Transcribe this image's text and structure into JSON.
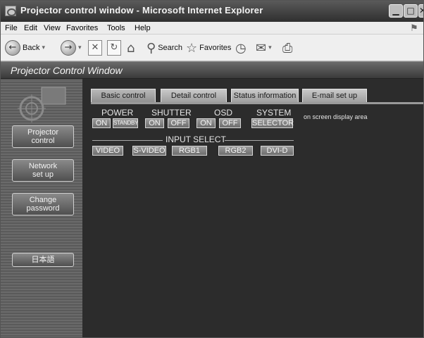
{
  "window": {
    "title": "Projector control window - Microsoft Internet Explorer",
    "controls": [
      "minimize-icon",
      "maximize-icon",
      "close-icon"
    ]
  },
  "menubar": {
    "items": [
      "File",
      "Edit",
      "View",
      "Favorites",
      "Tools",
      "Help"
    ]
  },
  "toolbar": {
    "back_label": "Back",
    "search_label": "Search",
    "favorites_label": "Favorites"
  },
  "page": {
    "title": "Projector Control Window"
  },
  "sidebar": {
    "logo_icon": "projector-logo-icon",
    "items": [
      {
        "label_1": "Projector",
        "label_2": "control"
      },
      {
        "label_1": "Network",
        "label_2": "set up"
      },
      {
        "label_1": "Change",
        "label_2": "password"
      },
      {
        "label_1": "日本語",
        "label_2": ""
      }
    ]
  },
  "tabs": [
    {
      "label": "Basic control",
      "active": true
    },
    {
      "label": "Detail control",
      "active": false
    },
    {
      "label": "Status information",
      "active": false
    },
    {
      "label": "E-mail set up",
      "active": false
    }
  ],
  "controls": {
    "power": {
      "label": "POWER",
      "on": "ON",
      "standby": "STANDBY"
    },
    "shutter": {
      "label": "SHUTTER",
      "on": "ON",
      "off": "OFF"
    },
    "osd": {
      "label": "OSD",
      "on": "ON",
      "off": "OFF"
    },
    "system": {
      "label": "SYSTEM",
      "selector": "SELECTOR"
    },
    "osd_area_text": "on screen display area",
    "input_select": {
      "label": "INPUT SELECT",
      "inputs": [
        "VIDEO",
        "S-VIDEO",
        "RGB1",
        "RGB2",
        "DVI-D"
      ]
    }
  },
  "colors": {
    "content_bg": "#2c2c2c",
    "sidebar_bg": "#5a5a5a",
    "button_face": "#8a8a8a"
  }
}
